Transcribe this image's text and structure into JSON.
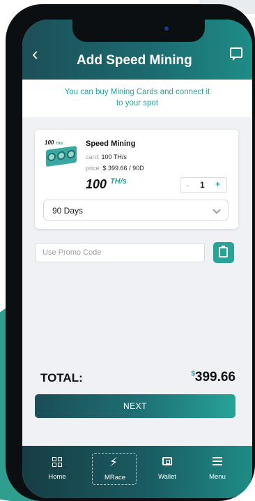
{
  "header": {
    "title": "Add Speed Mining"
  },
  "banner": {
    "line1": "You can buy Mining Cards and connect it",
    "line2": "to your spot"
  },
  "product": {
    "image_label_num": "100",
    "image_label_unit": "TH/s",
    "name": "Speed Mining",
    "card_label": "card:",
    "card_value": "100 TH/s",
    "price_label": "price:",
    "price_value": "$ 399.66 / 90D",
    "hashrate_value": "100",
    "hashrate_unit": "TH/s",
    "quantity": "1",
    "minus": "-",
    "plus": "+",
    "duration": "90 Days"
  },
  "promo": {
    "placeholder": "Use Promo Code"
  },
  "total": {
    "label": "TOTAL:",
    "currency": "$",
    "value": "399.66"
  },
  "actions": {
    "next_label": "NEXT"
  },
  "nav": {
    "items": [
      {
        "label": "Home",
        "icon": "grid-icon"
      },
      {
        "label": "MRace",
        "icon": "bolt-icon",
        "active": true
      },
      {
        "label": "Wallet",
        "icon": "wallet-icon"
      },
      {
        "label": "Menu",
        "icon": "menu-icon"
      }
    ]
  },
  "colors": {
    "accent": "#27a398",
    "header_dark": "#1d4f58",
    "background": "#eff1f4"
  }
}
